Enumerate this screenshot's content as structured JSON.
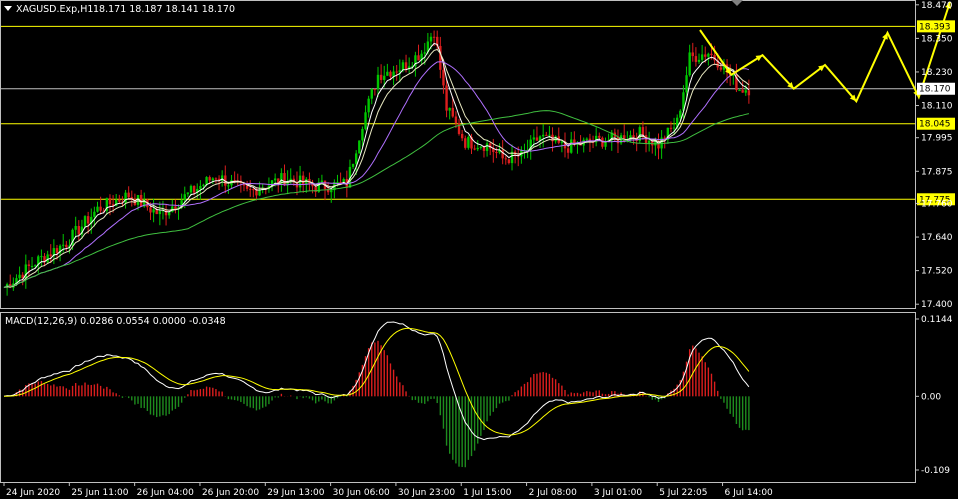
{
  "header": {
    "menu_icon": "triangle-down-icon",
    "symbol": "XAGUSD.Exp,H1",
    "ohlc": "18.171 18.187 18.141 18.170"
  },
  "indicator_header": "MACD(12,26,9) 0.0286 0.0554 0.0000 -0.0348",
  "colors": {
    "background": "#000000",
    "bull_candle": "#00c800",
    "bear_candle": "#dc1e1e",
    "level_line": "#ffff00",
    "arrow": "#ffff00",
    "ma_fast": "#ffffff",
    "ma_slow": "#b070ff",
    "ma_green": "#40c040",
    "current_price_line": "#c0c0c0",
    "grid_border": "#c0c0c0",
    "histogram_pos": "#dc1e1e",
    "histogram_neg": "#1e8c1e",
    "macd_line": "#ffffff",
    "signal_line": "#ffff00"
  },
  "chart_data": [
    {
      "type": "candlestick",
      "symbol": "XAGUSD.Exp",
      "timeframe": "H1",
      "price_axis_ticks": [
        "18.470",
        "18.350",
        "18.230",
        "18.110",
        "17.995",
        "17.875",
        "17.760",
        "17.640",
        "17.520",
        "17.400"
      ],
      "ylim": [
        17.39,
        18.48
      ],
      "time_axis_labels": [
        "24 Jun 2020",
        "25 Jun 11:00",
        "26 Jun 04:00",
        "26 Jun 20:00",
        "29 Jun 13:00",
        "30 Jun 06:00",
        "30 Jun 23:00",
        "1 Jul 15:00",
        "2 Jul 08:00",
        "3 Jul 01:00",
        "5 Jul 22:05",
        "6 Jul 14:00"
      ],
      "horizontal_levels": [
        {
          "value": 18.393,
          "label": "18.393"
        },
        {
          "value": 18.045,
          "label": "18.045"
        },
        {
          "value": 17.775,
          "label": "17.775"
        }
      ],
      "current_price": {
        "value": 18.17,
        "label": "18.170"
      },
      "price_path_anchors": [
        [
          0,
          17.46
        ],
        [
          10,
          17.55
        ],
        [
          20,
          17.62
        ],
        [
          30,
          17.74
        ],
        [
          40,
          17.79
        ],
        [
          50,
          17.72
        ],
        [
          60,
          17.8
        ],
        [
          68,
          17.86
        ],
        [
          78,
          17.8
        ],
        [
          90,
          17.85
        ],
        [
          100,
          17.82
        ],
        [
          110,
          17.83
        ],
        [
          115,
          18.05
        ],
        [
          120,
          18.22
        ],
        [
          128,
          18.25
        ],
        [
          134,
          18.3
        ],
        [
          138,
          18.38
        ],
        [
          142,
          18.1
        ],
        [
          148,
          17.98
        ],
        [
          155,
          17.97
        ],
        [
          160,
          17.92
        ],
        [
          166,
          17.93
        ],
        [
          172,
          18.0
        ],
        [
          180,
          17.96
        ],
        [
          188,
          17.98
        ],
        [
          196,
          17.99
        ],
        [
          204,
          18.01
        ],
        [
          210,
          17.97
        ],
        [
          216,
          18.05
        ],
        [
          220,
          18.28
        ],
        [
          226,
          18.3
        ],
        [
          230,
          18.26
        ],
        [
          236,
          18.17
        ]
      ],
      "projection_path": [
        18.38,
        18.22,
        18.29,
        18.17,
        18.255,
        18.125,
        18.37,
        18.14,
        18.48
      ]
    },
    {
      "type": "histogram",
      "name": "MACD(12,26,9)",
      "values_shown": [
        0.0286,
        0.0554,
        0.0,
        -0.0348
      ],
      "axis_ticks": [
        "0.1144",
        "0.00",
        "-0.109"
      ],
      "ylim": [
        -0.109,
        0.1144
      ]
    }
  ],
  "scroll_marker_icon": "triangle-down-icon"
}
